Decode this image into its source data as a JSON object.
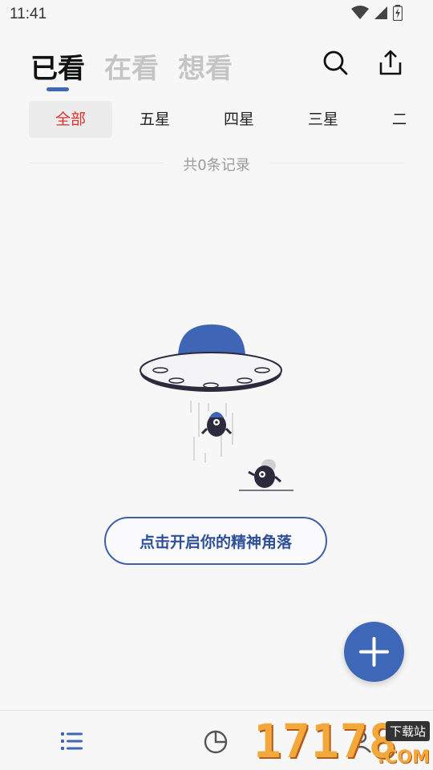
{
  "status_bar": {
    "time": "11:41",
    "icons": [
      "wifi-icon",
      "signal-icon",
      "battery-icon"
    ]
  },
  "header": {
    "tabs": [
      {
        "label": "已看",
        "active": true
      },
      {
        "label": "在看",
        "active": false
      },
      {
        "label": "想看",
        "active": false
      }
    ],
    "actions": [
      "search-icon",
      "share-icon"
    ]
  },
  "filters": [
    {
      "label": "全部",
      "active": true
    },
    {
      "label": "五星",
      "active": false
    },
    {
      "label": "四星",
      "active": false
    },
    {
      "label": "三星",
      "active": false
    },
    {
      "label": "二星",
      "active": false
    }
  ],
  "record_count": "共0条记录",
  "empty_state": {
    "illustration": "ufo-illustration",
    "button_label": "点击开启你的精神角落"
  },
  "fab": {
    "icon": "plus-icon"
  },
  "bottom_nav": [
    {
      "icon": "list-icon",
      "active": true
    },
    {
      "icon": "pie-chart-icon",
      "active": false
    },
    {
      "icon": "profile-icon",
      "active": false
    }
  ],
  "watermark": {
    "text": "17178",
    "tag": "下载站",
    "suffix": ".COM"
  },
  "colors": {
    "accent": "#3f67b7",
    "active_filter": "#e03030",
    "muted": "#c4c4c4"
  }
}
